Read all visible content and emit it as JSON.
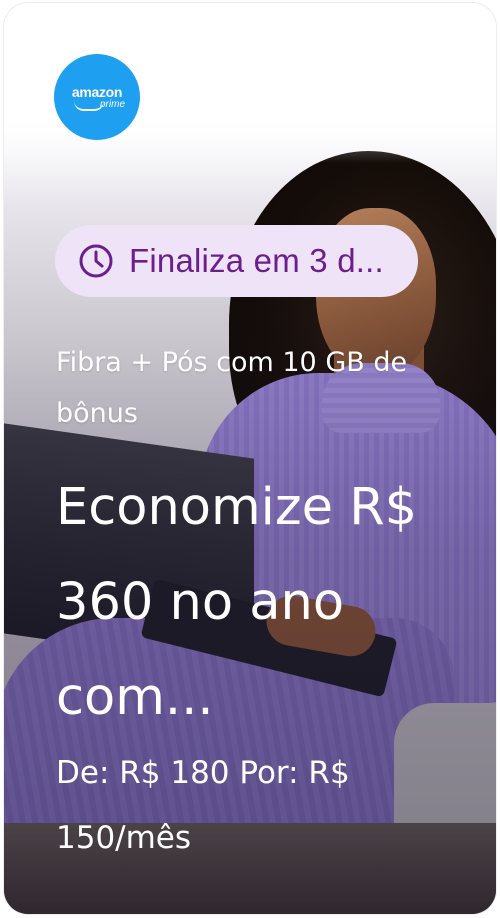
{
  "card": {
    "logo": {
      "line1": "amazon",
      "line2": "prime",
      "color": "#1e9ff0",
      "icon": "amazon-prime-logo"
    },
    "deadline_pill": {
      "text": "Finaliza em 3 d...",
      "icon": "clock-icon",
      "bg": "#efe3f7",
      "fg": "#6b1f8e"
    },
    "subtitle": "Fibra + Pós com 10 GB de bônus",
    "headline": "Economize R$ 360 no ano com...",
    "price": "De: R$ 180 Por: R$ 150/mês"
  }
}
